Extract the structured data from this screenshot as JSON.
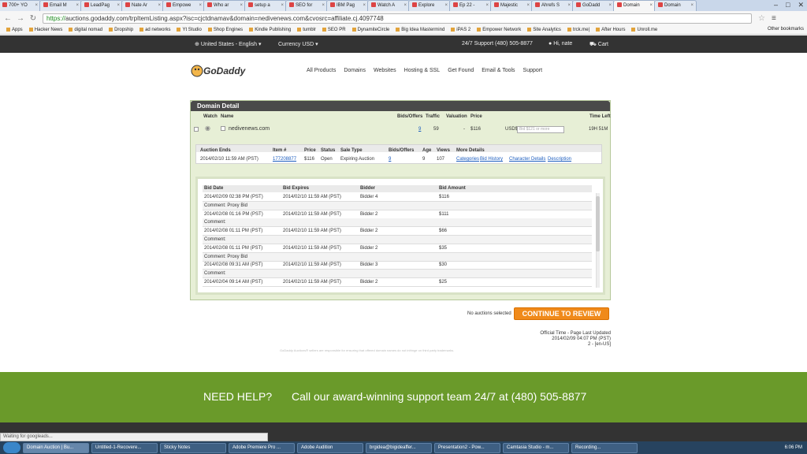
{
  "browser": {
    "tabs": [
      "700+ YO",
      "Email M",
      "LeadPag",
      "Nate Ar",
      "Empowe",
      "Who ar",
      "setup a",
      "SEO for",
      "IBM Pag",
      "Watch A",
      "Explore",
      "Ep 22 -",
      "Majestic",
      "Ahrefs S",
      "GoDadd",
      "Domain",
      "Domain"
    ],
    "active_tab_index": 15,
    "url_scheme": "https://",
    "url_rest": "auctions.godaddy.com/trpItemListing.aspx?isc=cjctdnamav&domain=nedivenews.com&cvosrc=affiliate.cj.4097748",
    "bookmarks": [
      "Apps",
      "Hacker News",
      "digital nomad",
      "Dropship",
      "ad networks",
      "Yt Studio",
      "Shop Engines",
      "Kindle Publishing",
      "tumblr",
      "SEO PR",
      "DynamiteCircle",
      "Big Idea Mastermind",
      "iPAS 2",
      "Empower Network",
      "Site Analytics",
      "trck.me|",
      "After Hours",
      "Unroll.me"
    ],
    "other_bookmarks": "Other bookmarks"
  },
  "topbar": {
    "region": "United States - English ▾",
    "currency": "Currency USD ▾",
    "support": "24/7 Support (480) 505-8877",
    "user": "Hi, nate",
    "cart": "Cart"
  },
  "logo_text": "GoDaddy",
  "nav": [
    "All Products",
    "Domains",
    "Websites",
    "Hosting & SSL",
    "Get Found",
    "Email & Tools",
    "Support"
  ],
  "panel": {
    "title": "Domain Detail",
    "headers": {
      "watch": "Watch",
      "name": "Name",
      "bids": "Bids/Offers",
      "traffic": "Traffic",
      "valuation": "Valuation",
      "price": "Price",
      "time_left": "Time Left"
    },
    "domain": "nedivenews.com",
    "bids": "9",
    "traffic": "59",
    "valuation": "-",
    "price": "$116",
    "currency": "USD$",
    "bid_placeholder": "Bid $121 or more",
    "time_left": "19H 51M"
  },
  "info": {
    "headers": [
      "Auction Ends",
      "Item #",
      "Price",
      "Status",
      "Sale Type",
      "Bids/Offers",
      "Age",
      "Views",
      "More Details"
    ],
    "values": [
      "2014/02/10 11:59 AM (PST)",
      "177208877",
      "$116",
      "Open",
      "Expiring Auction",
      "9",
      "9",
      "107"
    ],
    "links": [
      "Categories",
      "Bid History",
      "Character Details",
      "Description"
    ]
  },
  "bid_table": {
    "headers": [
      "Bid Date",
      "Bid Expires",
      "Bidder",
      "Bid Amount"
    ],
    "rows": [
      {
        "date": "2014/02/09 02:38 PM (PST)",
        "expires": "2014/02/10 11:59 AM (PST)",
        "bidder": "Bidder 4",
        "amount": "$116"
      },
      {
        "comment": "Comment: Proxy Bid"
      },
      {
        "date": "2014/02/08 01:16 PM (PST)",
        "expires": "2014/02/10 11:59 AM (PST)",
        "bidder": "Bidder 2",
        "amount": "$111"
      },
      {
        "comment": "Comment:"
      },
      {
        "date": "2014/02/08 01:11 PM (PST)",
        "expires": "2014/02/10 11:59 AM (PST)",
        "bidder": "Bidder 2",
        "amount": "$66"
      },
      {
        "comment": "Comment:"
      },
      {
        "date": "2014/02/08 01:11 PM (PST)",
        "expires": "2014/02/10 11:59 AM (PST)",
        "bidder": "Bidder 2",
        "amount": "$35"
      },
      {
        "comment": "Comment: Proxy Bid"
      },
      {
        "date": "2014/02/08 09:31 AM (PST)",
        "expires": "2014/02/10 11:59 AM (PST)",
        "bidder": "Bidder 3",
        "amount": "$30"
      },
      {
        "comment": "Comment:"
      },
      {
        "date": "2014/02/04 09:14 AM (PST)",
        "expires": "2014/02/10 11:59 AM (PST)",
        "bidder": "Bidder 2",
        "amount": "$25"
      }
    ]
  },
  "no_auctions": "No auctions selected",
  "cta": "CONTINUE TO REVIEW",
  "official": {
    "line1": "Official Time - Page Last Updated",
    "line2": "2014/02/09 04:07 PM (PST)",
    "line3": "2 - [en-US]"
  },
  "disclaimer": "GoDaddy Auctions® sellers are responsible for ensuring that offered domain names do not infringe on third party trademarks.",
  "help": {
    "title": "NEED HELP?",
    "text": "Call our award-winning support team 24/7 at (480) 505-8877"
  },
  "status_popup": "Waiting for googleads...",
  "taskbar": [
    "Domain Auction | Bu...",
    "Untitled-1-Recovere...",
    "Sticky Notes",
    "Adobe Premiere Pro ...",
    "Adobe Audition",
    "brgidea@bigideaffer...",
    "Presentation2 - Pow...",
    "Camtasia Studio - m...",
    "Recording..."
  ],
  "clock": "6:06 PM"
}
